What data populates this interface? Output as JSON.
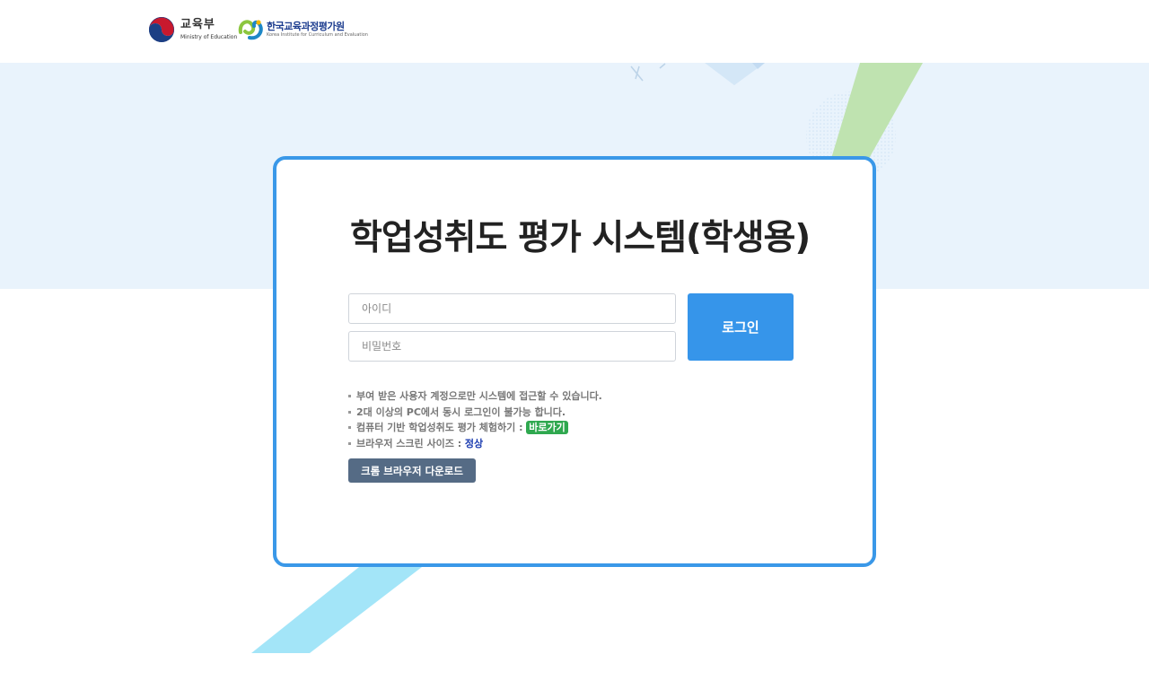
{
  "header": {
    "moe_logo": {
      "name_ko": "교육부",
      "name_en": "Ministry of Education",
      "icon": "taegeuk-emblem-icon"
    },
    "kice_logo": {
      "name_ko": "한국교육과정평가원",
      "name_en": "Korea Institute for Curriculum and Evaluation",
      "icon": "kice-emblem-icon"
    }
  },
  "login": {
    "title": "학업성취도 평가 시스템(학생용)",
    "id_placeholder": "아이디",
    "id_value": "",
    "pw_placeholder": "비밀번호",
    "pw_value": "",
    "login_label": "로그인"
  },
  "notes": {
    "line1": "부여 받은 사용자 계정으로만 시스템에 접근할 수 있습니다.",
    "line2": "2대 이상의 PC에서 동시 로그인이 불가능 합니다.",
    "line3_text": "컴퓨터 기반 학업성취도 평가 체험하기 : ",
    "line3_link": "바로가기",
    "line4_text": "브라우저 스크린 사이즈 : ",
    "line4_status": "정상"
  },
  "chrome_button_label": "크롬 브라우저 다운로드",
  "colors": {
    "accent": "#3695ea",
    "card_border": "#3a98e8",
    "band_background": "#e9f3fc",
    "link_badge": "#2fa84f",
    "status_ok": "#1a3bb0",
    "secondary_button": "#556b85"
  }
}
